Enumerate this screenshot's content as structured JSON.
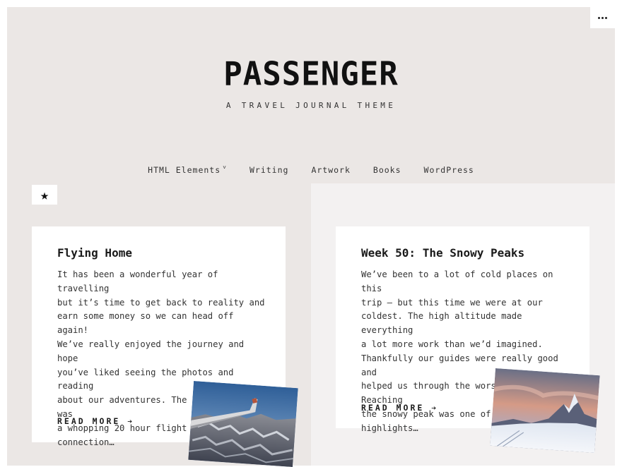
{
  "site": {
    "title": "PASSENGER",
    "description": "A TRAVEL JOURNAL THEME"
  },
  "nav": {
    "items": [
      {
        "label": "HTML Elements",
        "has_dropdown": true
      },
      {
        "label": "Writing"
      },
      {
        "label": "Artwork"
      },
      {
        "label": "Books"
      },
      {
        "label": "WordPress"
      }
    ]
  },
  "posts": [
    {
      "title": "Flying Home",
      "excerpt_lines": [
        "It has been a wonderful year of travelling",
        "but it’s time to get back to reality and",
        "earn some money so we can head off again!",
        "We’ve really enjoyed the journey and hope",
        "you’ve liked seeing the photos and reading",
        "about our adventures. The journey home was",
        "a whopping 20 hour flight with a",
        "connection…"
      ],
      "read_more": "READ MORE ➔",
      "sticky": true,
      "image_alt": "airplane-wing-over-mountains"
    },
    {
      "title": "Week 50: The Snowy Peaks",
      "excerpt_lines": [
        "We’ve been to a lot of cold places on this",
        "trip — but this time we were at our",
        "coldest. The high altitude made everything",
        "a lot more work than we’d imagined.",
        "Thankfully our guides were really good and",
        "helped us through the worst of it. Reaching",
        "the snowy peak was one of the highlights…"
      ],
      "read_more": "READ MORE ➔",
      "image_alt": "snowy-mountain-peak-at-dusk"
    }
  ],
  "icons": {
    "menu": "more-horizontal-icon",
    "sticky": "star-icon"
  },
  "colors": {
    "header_bg": "#ebe7e5",
    "left_col_bg": "#ebe7e5",
    "right_col_bg": "#f3f1f1",
    "card_bg": "#ffffff",
    "text": "#222222"
  }
}
